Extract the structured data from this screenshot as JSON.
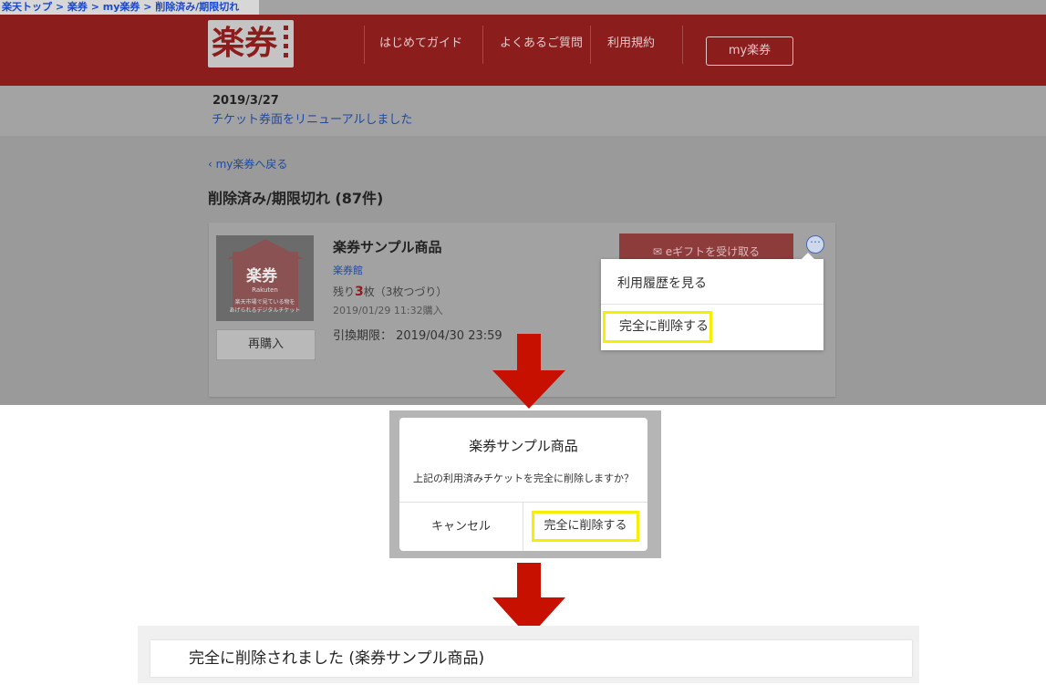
{
  "breadcrumb": {
    "text": "楽天トップ > 楽券 > my楽券 > 削除済み/期限切れ"
  },
  "header": {
    "logo_text": "楽券",
    "nav": [
      {
        "label": "はじめてガイド"
      },
      {
        "label": "よくあるご質問"
      },
      {
        "label": "利用規約"
      }
    ],
    "my_button": "my楽券"
  },
  "notice": {
    "date": "2019/3/27",
    "link": "チケット券面をリニューアルしました"
  },
  "page": {
    "back_link": "‹ my楽券へ戻る",
    "title": "削除済み/期限切れ (87件)"
  },
  "ticket": {
    "thumbnail": {
      "logo": "楽券",
      "brand": "Rakuten",
      "caption_line1": "楽天市場で見ている物を",
      "caption_line2": "あげられるデジタルチケット"
    },
    "name": "楽券サンプル商品",
    "shop": "楽券館",
    "remain_prefix": "残り",
    "remain_count": "3",
    "remain_suffix": "枚（3枚つづり）",
    "purchased": "2019/01/29 11:32購入",
    "expiry": "引換期限： 2019/04/30 23:59",
    "repurchase_label": "再購入",
    "gift_button": "✉ eギフトを受け取る"
  },
  "menu": {
    "history": "利用履歴を見る",
    "delete": "完全に削除する"
  },
  "dialog": {
    "title": "楽券サンプル商品",
    "message": "上記の利用済みチケットを完全に削除しますか？",
    "cancel": "キャンセル",
    "confirm": "完全に削除する"
  },
  "toast": {
    "text": "完全に削除されました (楽券サンプル商品)"
  },
  "colors": {
    "brand_red": "#8b1d1d",
    "arrow_red": "#c81000",
    "highlight_yellow": "#f5f000",
    "link_blue": "#204a9e"
  },
  "icons": {
    "more": "more-dots-icon",
    "mail": "mail-icon",
    "arrow": "arrow-down-icon"
  }
}
